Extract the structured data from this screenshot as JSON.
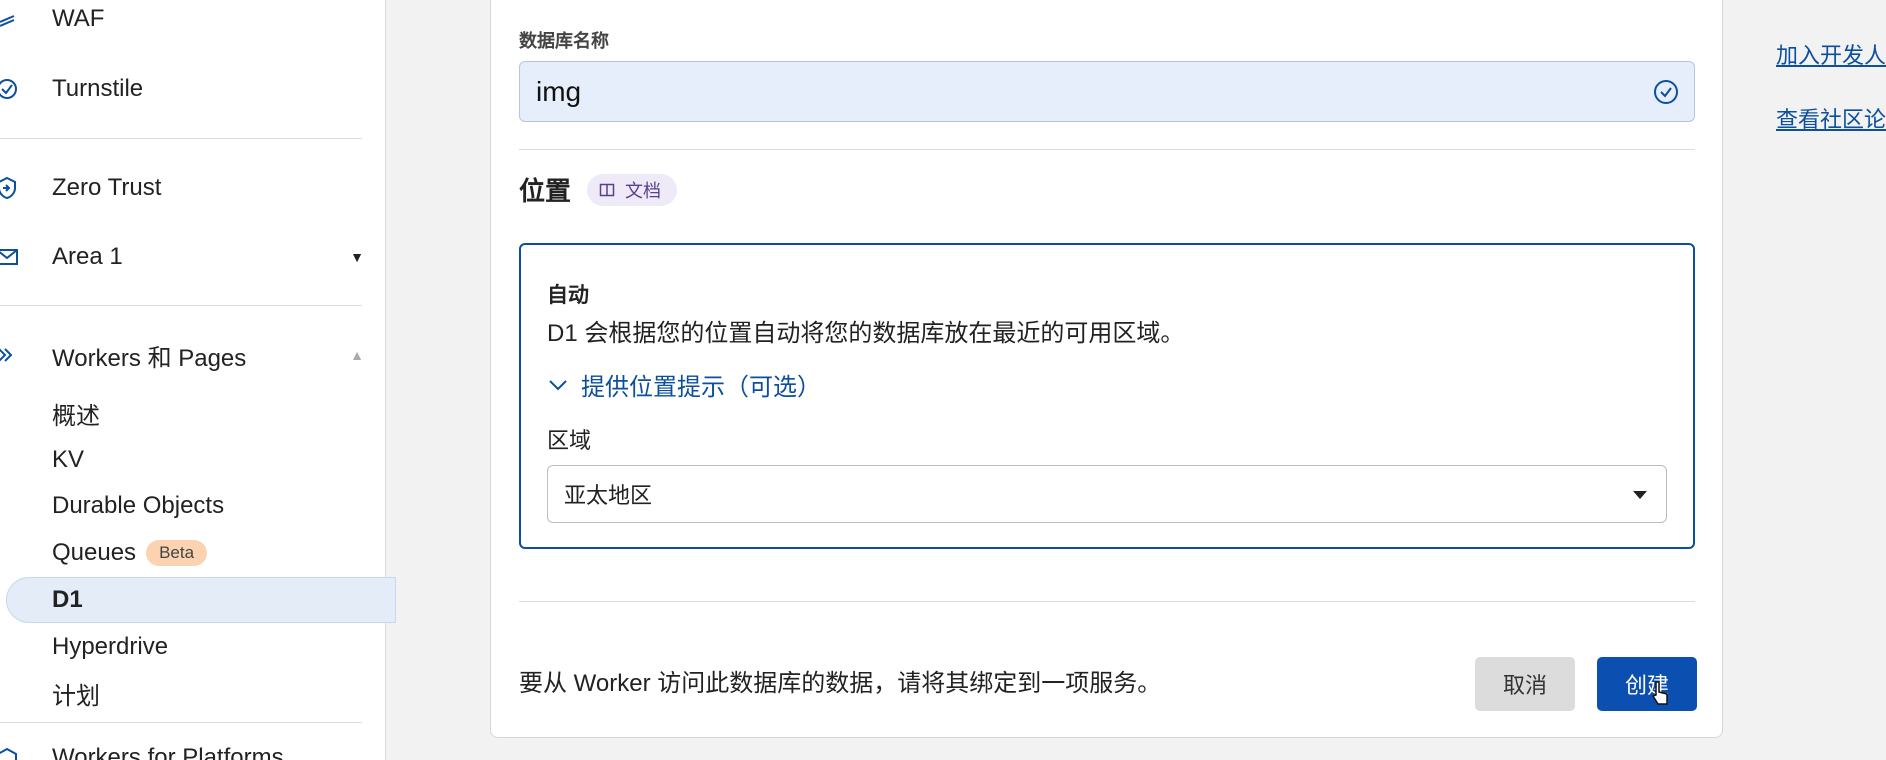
{
  "sidebar": {
    "items": [
      {
        "label": "WAF",
        "icon": "waf-icon"
      },
      {
        "label": "Turnstile",
        "icon": "turnstile-icon"
      },
      {
        "label": "Zero Trust",
        "icon": "zero-trust-icon"
      },
      {
        "label": "Area 1",
        "icon": "mail-icon",
        "caret": "▼"
      },
      {
        "label": "Workers 和 Pages",
        "icon": "workers-icon",
        "caret": "▲"
      },
      {
        "label": "Workers for Platforms",
        "icon": "platforms-icon"
      }
    ],
    "sub_items": [
      {
        "label": "概述"
      },
      {
        "label": "KV"
      },
      {
        "label": "Durable Objects"
      },
      {
        "label": "Queues",
        "badge": "Beta"
      },
      {
        "label": "D1",
        "active": true
      },
      {
        "label": "Hyperdrive"
      },
      {
        "label": "计划"
      }
    ]
  },
  "form": {
    "db_name_label": "数据库名称",
    "db_name_value": "img",
    "location_title": "位置",
    "docs_chip": "文档",
    "auto_title": "自动",
    "auto_desc": "D1 会根据您的位置自动将您的数据库放在最近的可用区域。",
    "hint_link": "提供位置提示（可选）",
    "region_label": "区域",
    "region_value": "亚太地区",
    "footer_text": "要从 Worker 访问此数据库的数据，请将其绑定到一项服务。",
    "cancel_label": "取消",
    "create_label": "创建"
  },
  "right_links": [
    {
      "label": "加入开发人"
    },
    {
      "label": "查看社区论"
    }
  ],
  "colors": {
    "accent": "#0b4fb0",
    "input_bg": "#e6eefc",
    "badge_bg": "#fbd3b0"
  }
}
